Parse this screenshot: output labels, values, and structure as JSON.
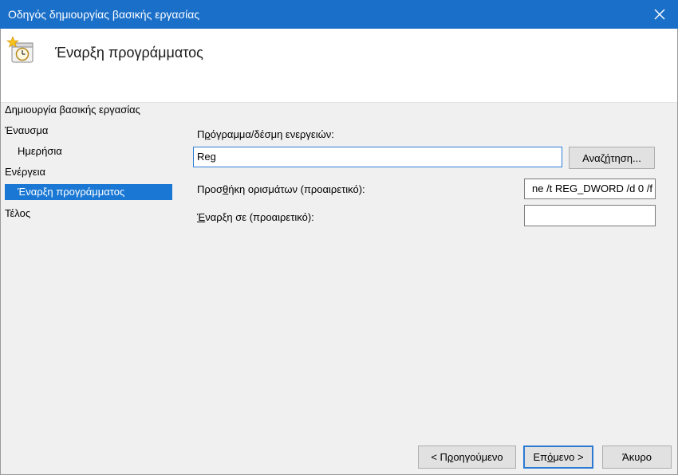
{
  "window": {
    "title": "Οδηγός δημιουργίας βασικής εργασίας",
    "accent_color": "#1a6fc9"
  },
  "header": {
    "heading": "Έναρξη προγράμματος",
    "icon": "task-clock-icon"
  },
  "steps": [
    {
      "label": "Δημιουργία βασικής εργασίας",
      "selected": false
    },
    {
      "label": "Έναυσμα",
      "selected": false
    },
    {
      "label": "Ημερήσια",
      "selected": false
    },
    {
      "label": "Ενέργεια",
      "selected": false
    },
    {
      "label": "Έναρξη προγράμματος",
      "selected": true
    },
    {
      "label": "Τέλος",
      "selected": false
    }
  ],
  "form": {
    "program_label_pre": "Π",
    "program_label_acc": "ρ",
    "program_label_post": "όγραμμα/δέσμη ενεργειών:",
    "program_value": "Reg",
    "browse_pre": "Αναζ",
    "browse_acc": "ή",
    "browse_post": "τηση...",
    "args_label_pre": "Προσ",
    "args_label_acc": "θ",
    "args_label_post": "ήκη ορισμάτων (προαιρετικό):",
    "args_value": "ne /t REG_DWORD /d 0 /f",
    "start_in_label_pre": "",
    "start_in_label_acc": "Έ",
    "start_in_label_post": "ναρξη σε (προαιρετικό):",
    "start_in_value": ""
  },
  "buttons": {
    "back_pre": "< Π",
    "back_acc": "ρ",
    "back_post": "οηγούμενο",
    "next_pre": "Επ",
    "next_acc": "ό",
    "next_post": "μενο >",
    "cancel": "Άκυρο"
  }
}
